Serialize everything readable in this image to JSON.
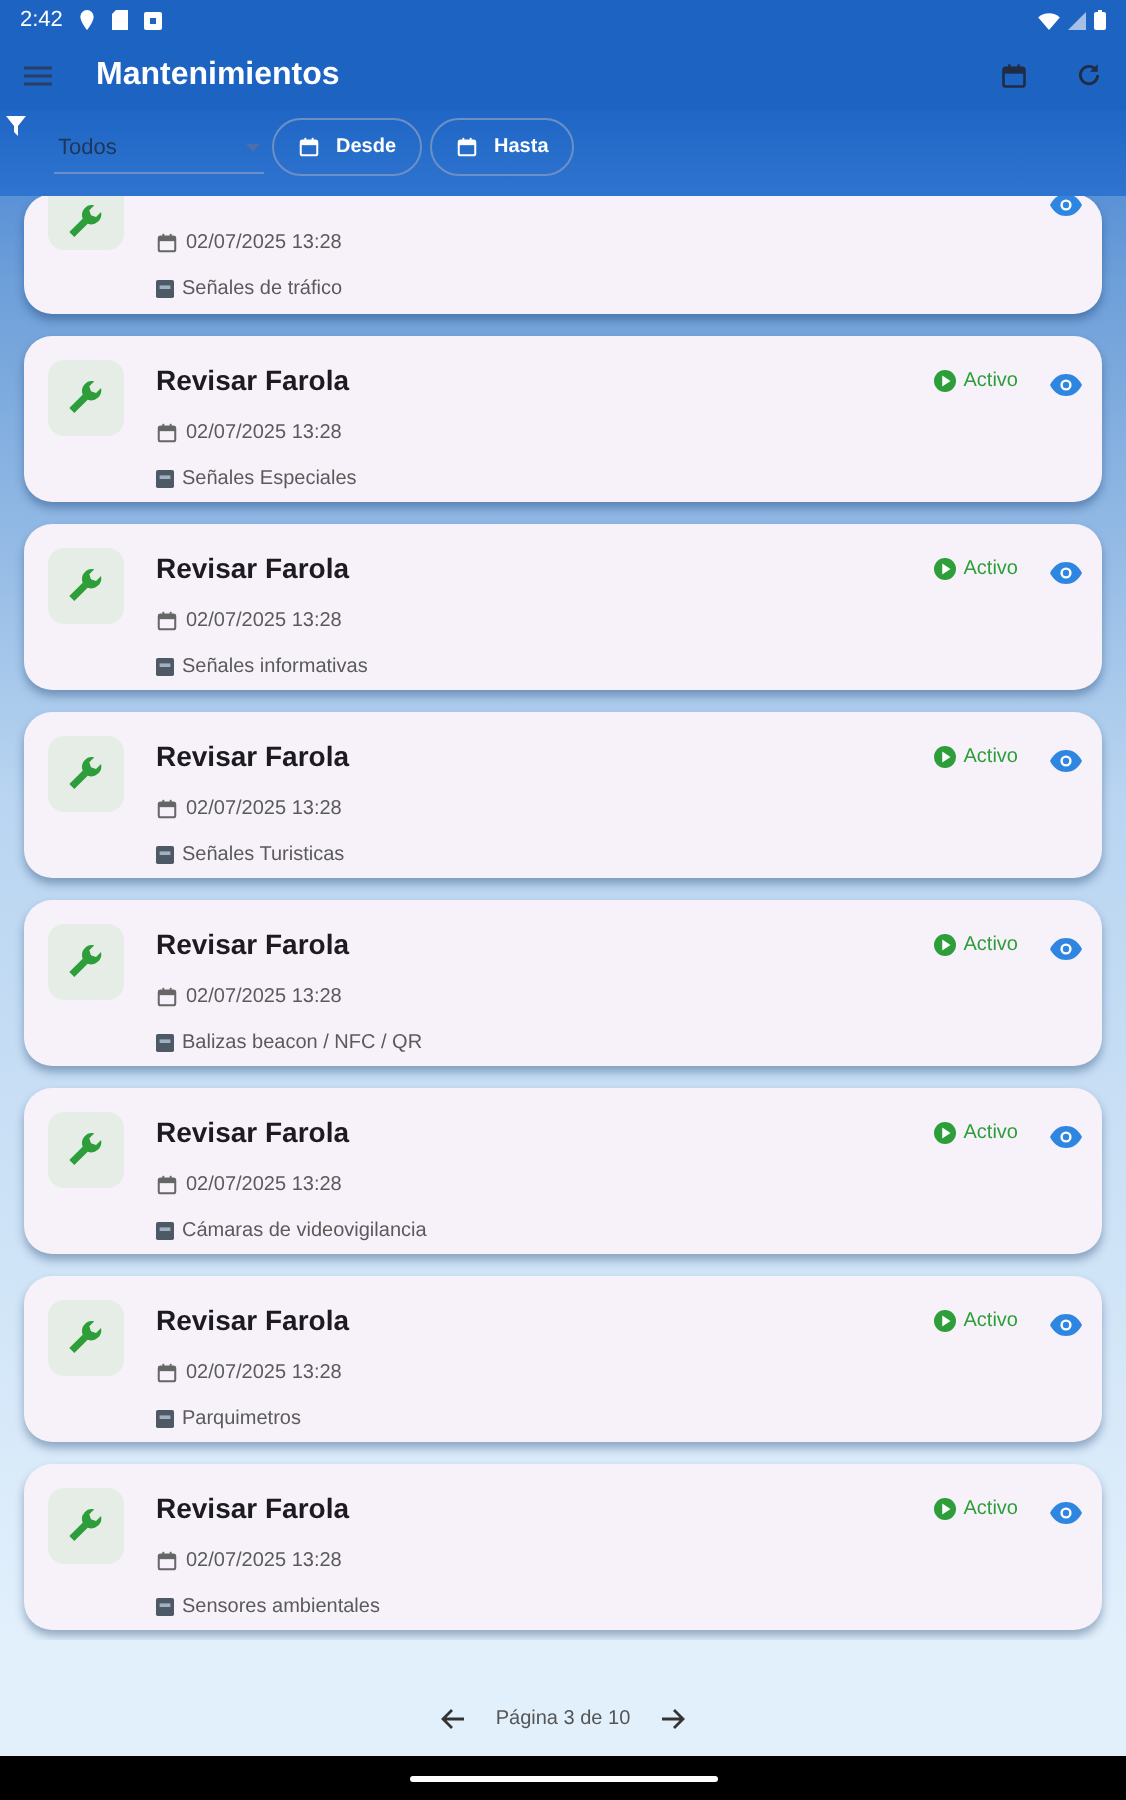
{
  "status_bar": {
    "time": "2:42"
  },
  "app_bar": {
    "title": "Mantenimientos"
  },
  "filters": {
    "type_value": "Todos",
    "buttons": [
      "Desde",
      "Hasta"
    ]
  },
  "items": [
    {
      "partial": true,
      "date": "02/07/2025 13:28",
      "category": "Señales de tráfico"
    },
    {
      "partial": false,
      "title": "Revisar Farola",
      "status": "Activo",
      "date": "02/07/2025 13:28",
      "category": "Señales Especiales"
    },
    {
      "partial": false,
      "title": "Revisar Farola",
      "status": "Activo",
      "date": "02/07/2025 13:28",
      "category": "Señales informativas"
    },
    {
      "partial": false,
      "title": "Revisar Farola",
      "status": "Activo",
      "date": "02/07/2025 13:28",
      "category": "Señales Turisticas"
    },
    {
      "partial": false,
      "title": "Revisar Farola",
      "status": "Activo",
      "date": "02/07/2025 13:28",
      "category": "Balizas beacon / NFC / QR"
    },
    {
      "partial": false,
      "title": "Revisar Farola",
      "status": "Activo",
      "date": "02/07/2025 13:28",
      "category": "Cámaras de videovigilancia"
    },
    {
      "partial": false,
      "title": "Revisar Farola",
      "status": "Activo",
      "date": "02/07/2025 13:28",
      "category": "Parquimetros"
    },
    {
      "partial": false,
      "title": "Revisar Farola",
      "status": "Activo",
      "date": "02/07/2025 13:28",
      "category": "Sensores ambientales"
    }
  ],
  "pagination": {
    "label": "Página 3 de 10"
  }
}
